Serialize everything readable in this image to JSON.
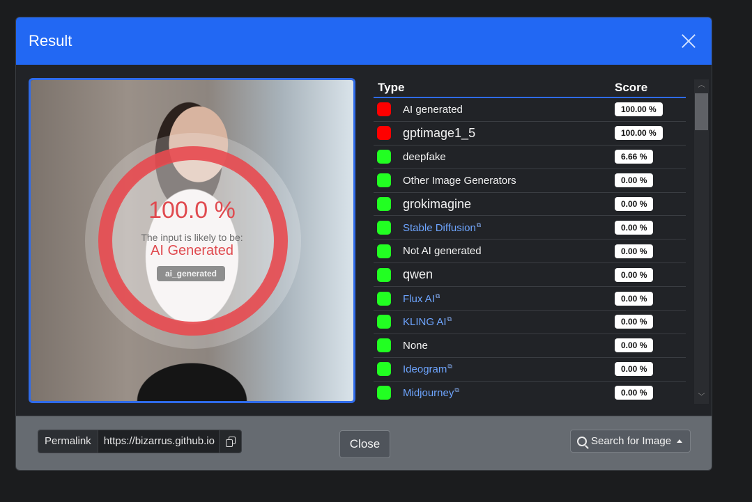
{
  "modal": {
    "title": "Result"
  },
  "gauge": {
    "percent_text": "100.0 %",
    "percent_value": 100.0,
    "subtitle": "The input is likely to be:",
    "label": "AI Generated",
    "badge": "ai_generated",
    "color": "#e04a4f"
  },
  "table": {
    "headers": {
      "type": "Type",
      "score": "Score"
    },
    "rows": [
      {
        "name": "AI generated",
        "score": "100.00 %",
        "color": "#ff0000",
        "link": false,
        "large": false
      },
      {
        "name": "gptimage1_5",
        "score": "100.00 %",
        "color": "#ff0000",
        "link": false,
        "large": true
      },
      {
        "name": "deepfake",
        "score": "6.66 %",
        "color": "#22ff22",
        "link": false,
        "large": false
      },
      {
        "name": "Other Image Generators",
        "score": "0.00 %",
        "color": "#22ff22",
        "link": false,
        "large": false
      },
      {
        "name": "grokimagine",
        "score": "0.00 %",
        "color": "#22ff22",
        "link": false,
        "large": true
      },
      {
        "name": "Stable Diffusion",
        "score": "0.00 %",
        "color": "#22ff22",
        "link": true,
        "large": false
      },
      {
        "name": "Not AI generated",
        "score": "0.00 %",
        "color": "#22ff22",
        "link": false,
        "large": false
      },
      {
        "name": "qwen",
        "score": "0.00 %",
        "color": "#22ff22",
        "link": false,
        "large": true
      },
      {
        "name": "Flux AI",
        "score": "0.00 %",
        "color": "#22ff22",
        "link": true,
        "large": false
      },
      {
        "name": "KLING AI",
        "score": "0.00 %",
        "color": "#22ff22",
        "link": true,
        "large": false
      },
      {
        "name": "None",
        "score": "0.00 %",
        "color": "#22ff22",
        "link": false,
        "large": false
      },
      {
        "name": "Ideogram",
        "score": "0.00 %",
        "color": "#22ff22",
        "link": true,
        "large": false
      },
      {
        "name": "Midjourney",
        "score": "0.00 %",
        "color": "#22ff22",
        "link": true,
        "large": false
      }
    ]
  },
  "footer": {
    "permalink_label": "Permalink",
    "permalink_value": "https://bizarrus.github.io",
    "close_label": "Close",
    "search_label": "Search for Image"
  },
  "icons": {
    "close": "close-icon",
    "copy": "copy-icon",
    "search": "search-icon",
    "external": "external-link-icon",
    "caret": "caret-up-icon"
  }
}
